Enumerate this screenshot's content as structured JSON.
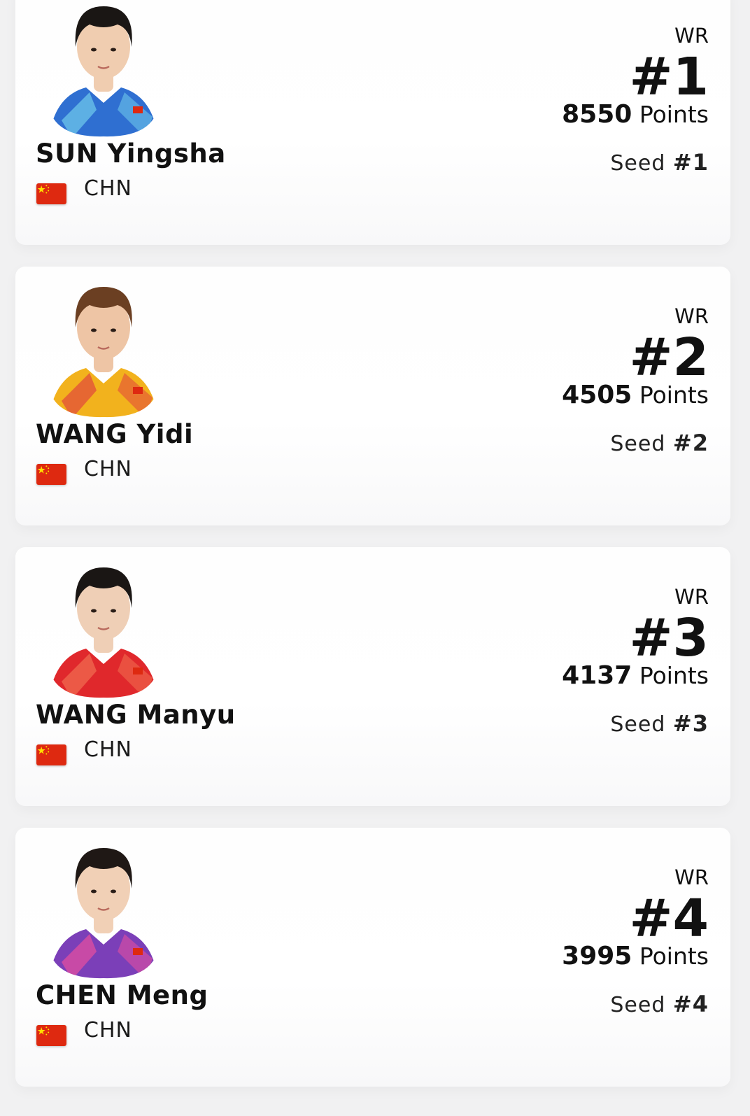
{
  "players": [
    {
      "name": "SUN Yingsha",
      "country": "CHN",
      "wr_label": "WR",
      "wr_rank": "#1",
      "points": "8550",
      "points_label": "Points",
      "seed_label": "Seed",
      "seed": "#1",
      "colors": {
        "jersey": "#2f6fd1",
        "jersey_accent": "#6ec6ea",
        "hair": "#1a1614",
        "skin": "#f0cdb0"
      }
    },
    {
      "name": "WANG Yidi",
      "country": "CHN",
      "wr_label": "WR",
      "wr_rank": "#2",
      "points": "4505",
      "points_label": "Points",
      "seed_label": "Seed",
      "seed": "#2",
      "colors": {
        "jersey": "#f2b21d",
        "jersey_accent": "#e24d3a",
        "hair": "#6b3f22",
        "skin": "#eec5a5"
      }
    },
    {
      "name": "WANG Manyu",
      "country": "CHN",
      "wr_label": "WR",
      "wr_rank": "#3",
      "points": "4137",
      "points_label": "Points",
      "seed_label": "Seed",
      "seed": "#3",
      "colors": {
        "jersey": "#e0282c",
        "jersey_accent": "#f06a4f",
        "hair": "#1a1614",
        "skin": "#efcfb6"
      }
    },
    {
      "name": "CHEN Meng",
      "country": "CHN",
      "wr_label": "WR",
      "wr_rank": "#4",
      "points": "3995",
      "points_label": "Points",
      "seed_label": "Seed",
      "seed": "#4",
      "colors": {
        "jersey": "#7b3fb8",
        "jersey_accent": "#e24fa0",
        "hair": "#1f1815",
        "skin": "#f1d0b6"
      }
    }
  ],
  "flag_colors": {
    "field": "#de2910",
    "star": "#ffde00"
  }
}
